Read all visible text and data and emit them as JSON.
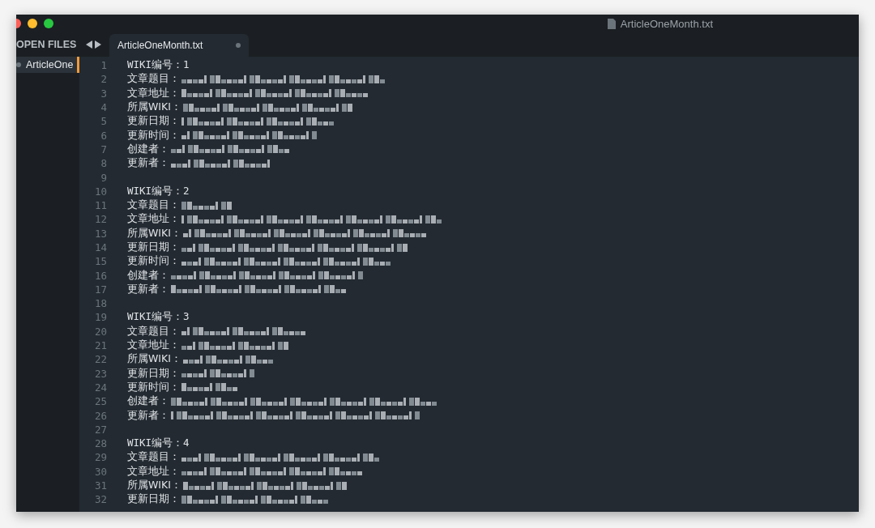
{
  "window": {
    "title": "ArticleOneMonth.txt"
  },
  "sidebar": {
    "heading": "OPEN FILES",
    "files": [
      {
        "name": "ArticleOne",
        "selected": true,
        "modified": true
      }
    ]
  },
  "tabs": [
    {
      "label": "ArticleOneMonth.txt",
      "selected": true,
      "modified": true
    }
  ],
  "lines": [
    {
      "number": "1",
      "kind": "text",
      "text": "WIKI编号：1"
    },
    {
      "number": "2",
      "kind": "field",
      "label": "文章题目："
    },
    {
      "number": "3",
      "kind": "field",
      "label": "文章地址："
    },
    {
      "number": "4",
      "kind": "field",
      "label": "所属WIKI："
    },
    {
      "number": "5",
      "kind": "field",
      "label": "更新日期："
    },
    {
      "number": "6",
      "kind": "field",
      "label": "更新时间："
    },
    {
      "number": "7",
      "kind": "field",
      "label": "创建者："
    },
    {
      "number": "8",
      "kind": "field",
      "label": "更新者："
    },
    {
      "number": "9",
      "kind": "blank"
    },
    {
      "number": "10",
      "kind": "text",
      "text": "WIKI编号：2"
    },
    {
      "number": "11",
      "kind": "field",
      "label": "文章题目："
    },
    {
      "number": "12",
      "kind": "field",
      "label": "文章地址："
    },
    {
      "number": "13",
      "kind": "field",
      "label": "所属WIKI："
    },
    {
      "number": "14",
      "kind": "field",
      "label": "更新日期："
    },
    {
      "number": "15",
      "kind": "field",
      "label": "更新时间："
    },
    {
      "number": "16",
      "kind": "field",
      "label": "创建者："
    },
    {
      "number": "17",
      "kind": "field",
      "label": "更新者："
    },
    {
      "number": "18",
      "kind": "blank"
    },
    {
      "number": "19",
      "kind": "text",
      "text": "WIKI编号：3"
    },
    {
      "number": "20",
      "kind": "field",
      "label": "文章题目："
    },
    {
      "number": "21",
      "kind": "field",
      "label": "文章地址："
    },
    {
      "number": "22",
      "kind": "field",
      "label": "所属WIKI："
    },
    {
      "number": "23",
      "kind": "field",
      "label": "更新日期："
    },
    {
      "number": "24",
      "kind": "field",
      "label": "更新时间："
    },
    {
      "number": "25",
      "kind": "field",
      "label": "创建者："
    },
    {
      "number": "26",
      "kind": "field",
      "label": "更新者："
    },
    {
      "number": "27",
      "kind": "blank"
    },
    {
      "number": "28",
      "kind": "text",
      "text": "WIKI编号：4"
    },
    {
      "number": "29",
      "kind": "field",
      "label": "文章题目："
    },
    {
      "number": "30",
      "kind": "field",
      "label": "文章地址："
    },
    {
      "number": "31",
      "kind": "field",
      "label": "所属WIKI："
    },
    {
      "number": "32",
      "kind": "field",
      "label": "更新日期："
    }
  ]
}
